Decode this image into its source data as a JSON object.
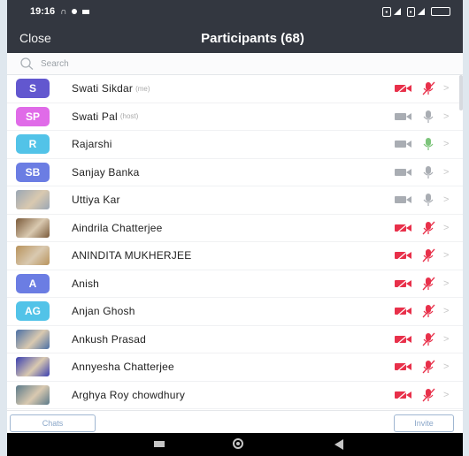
{
  "status": {
    "time": "19:16",
    "right_text": "LTE",
    "battery": "100"
  },
  "header": {
    "close_label": "Close",
    "title": "Participants (68)"
  },
  "search": {
    "placeholder": "Search"
  },
  "participants": [
    {
      "name": "Swati Sikdar",
      "role": "(me)",
      "avatar_text": "S",
      "avatar_color": "#6257cf",
      "video_muted": true,
      "mic_muted": true
    },
    {
      "name": "Swati Pal",
      "role": "(host)",
      "avatar_text": "SP",
      "avatar_color": "#e06be8",
      "video_muted": false,
      "mic_muted": false
    },
    {
      "name": "Rajarshi",
      "role": "",
      "avatar_text": "R",
      "avatar_color": "#52c3e8",
      "video_muted": false,
      "mic_muted": false,
      "mic_active": true
    },
    {
      "name": "Sanjay Banka",
      "role": "",
      "avatar_text": "SB",
      "avatar_color": "#6b7de3",
      "video_muted": false,
      "mic_muted": false
    },
    {
      "name": "Uttiya Kar",
      "role": "",
      "avatar_text": "",
      "avatar_color": "#9aa6b4",
      "photo": true,
      "video_muted": false,
      "mic_muted": false
    },
    {
      "name": "Aindrila Chatterjee",
      "role": "",
      "avatar_text": "",
      "avatar_color": "#7a5a3a",
      "photo": true,
      "video_muted": true,
      "mic_muted": true
    },
    {
      "name": "ANINDITA MUKHERJEE",
      "role": "",
      "avatar_text": "",
      "avatar_color": "#b8935c",
      "photo": true,
      "video_muted": true,
      "mic_muted": true
    },
    {
      "name": "Anish",
      "role": "",
      "avatar_text": "A",
      "avatar_color": "#6b7de3",
      "video_muted": true,
      "mic_muted": true
    },
    {
      "name": "Anjan Ghosh",
      "role": "",
      "avatar_text": "AG",
      "avatar_color": "#52c3e8",
      "video_muted": true,
      "mic_muted": true
    },
    {
      "name": "Ankush Prasad",
      "role": "",
      "avatar_text": "",
      "avatar_color": "#4a6fa5",
      "photo": true,
      "video_muted": true,
      "mic_muted": true
    },
    {
      "name": "Annyesha Chatterjee",
      "role": "",
      "avatar_text": "",
      "avatar_color": "#3a3fb0",
      "photo": true,
      "video_muted": true,
      "mic_muted": true
    },
    {
      "name": "Arghya Roy chowdhury",
      "role": "",
      "avatar_text": "",
      "avatar_color": "#5c7a8a",
      "photo": true,
      "video_muted": true,
      "mic_muted": true
    }
  ],
  "footer": {
    "chats_label": "Chats",
    "invite_label": "Invite"
  },
  "colors": {
    "header_bg": "#333740",
    "muted_red": "#e8304a",
    "unmuted_gray": "#a9adb3",
    "mic_active_green": "#7cc47a",
    "button_border": "#9fb6d1"
  }
}
